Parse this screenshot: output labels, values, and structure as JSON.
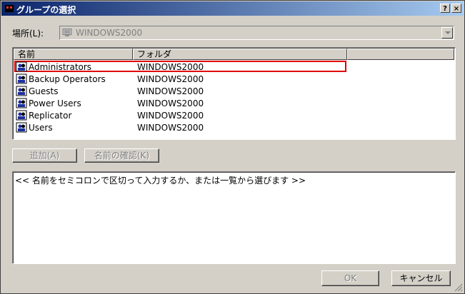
{
  "window": {
    "title": "グループの選択",
    "help_glyph": "?",
    "close_glyph": "×"
  },
  "location": {
    "label": "場所(L):",
    "value": "WINDOWS2000"
  },
  "list": {
    "columns": [
      "名前",
      "フォルダ",
      ""
    ],
    "rows": [
      {
        "name": "Administrators",
        "folder": "WINDOWS2000",
        "selected": true
      },
      {
        "name": "Backup Operators",
        "folder": "WINDOWS2000"
      },
      {
        "name": "Guests",
        "folder": "WINDOWS2000"
      },
      {
        "name": "Power Users",
        "folder": "WINDOWS2000"
      },
      {
        "name": "Replicator",
        "folder": "WINDOWS2000"
      },
      {
        "name": "Users",
        "folder": "WINDOWS2000"
      }
    ]
  },
  "buttons": {
    "add": "追加(A)",
    "check_names": "名前の確認(K)",
    "ok": "OK",
    "cancel": "キャンセル"
  },
  "namebox": {
    "text": "<< 名前をセミコロンで区切って入力するか、または一覧から選びます >>"
  },
  "colors": {
    "selection_outline": "#e00000",
    "title_bar": "#0a246a",
    "face": "#d4d0c8"
  },
  "icons": {
    "group": "group-users-icon",
    "computer": "computer-icon"
  }
}
